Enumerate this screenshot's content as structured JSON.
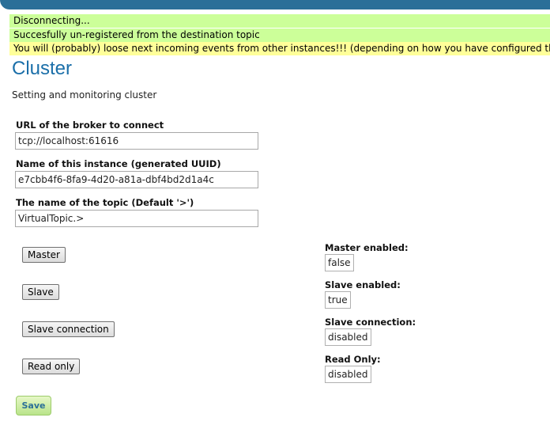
{
  "messages": [
    {
      "text": "Disconnecting...",
      "type": "info"
    },
    {
      "text": "Succesfully un-registered from the destination topic",
      "type": "info"
    },
    {
      "text": "You will (probably) loose next incoming events from other instances!!! (depending on how you have configured the broker)",
      "type": "warning"
    }
  ],
  "page": {
    "title": "Cluster",
    "subtitle": "Setting and monitoring cluster"
  },
  "fields": {
    "broker_url": {
      "label": "URL of the broker to connect",
      "value": "tcp://localhost:61616"
    },
    "instance_name": {
      "label": "Name of this instance (generated UUID)",
      "value": "e7cbb4f6-8fa9-4d20-a81a-dbf4bd2d1a4c"
    },
    "topic_name": {
      "label": "The name of the topic (Default '>')",
      "value": "VirtualTopic.>"
    }
  },
  "buttons": {
    "master": "Master",
    "slave": "Slave",
    "slave_connection": "Slave connection",
    "read_only": "Read only",
    "save": "Save"
  },
  "status": {
    "master_enabled": {
      "label": "Master enabled:",
      "value": "false"
    },
    "slave_enabled": {
      "label": "Slave enabled:",
      "value": "true"
    },
    "slave_connection": {
      "label": "Slave connection:",
      "value": "disabled"
    },
    "read_only": {
      "label": "Read Only:",
      "value": "disabled"
    }
  },
  "colors": {
    "info_bg": "#ccff99",
    "warning_bg": "#ffff99",
    "title": "#1b6fa9",
    "header_bar": "#2b6f98"
  }
}
